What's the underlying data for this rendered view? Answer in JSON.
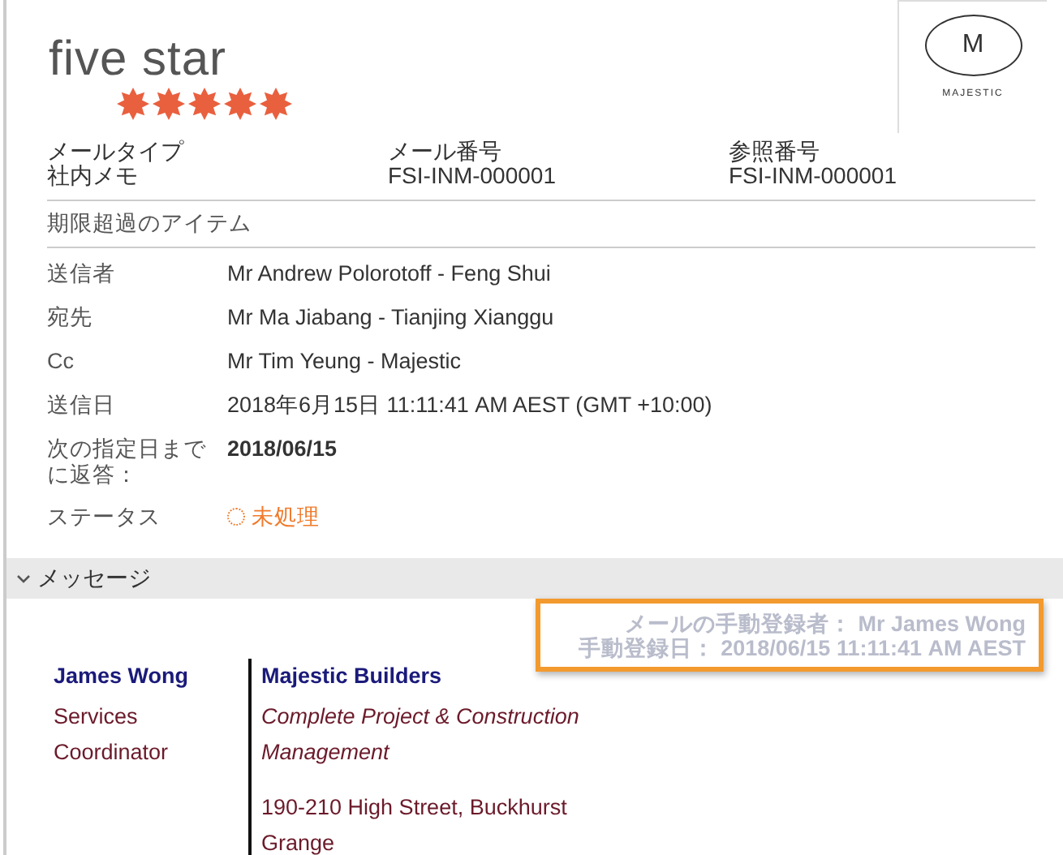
{
  "logo": {
    "wordmark": "five star",
    "stars": 5
  },
  "brand_logo": {
    "letter": "M",
    "name": "MAJESTIC"
  },
  "header_fields": [
    {
      "label": "メールタイプ",
      "value": "社内メモ"
    },
    {
      "label": "メール番号",
      "value": "FSI-INM-000001"
    },
    {
      "label": "参照番号",
      "value": "FSI-INM-000001"
    }
  ],
  "overdue_label": "期限超過のアイテム",
  "details": [
    {
      "label": "送信者",
      "value": "Mr Andrew Polorotoff - Feng Shui",
      "kind": "text"
    },
    {
      "label": "宛先",
      "value": "Mr Ma Jiabang - Tianjing Xianggu",
      "kind": "text"
    },
    {
      "label": "Cc",
      "value": "Mr Tim Yeung - Majestic",
      "kind": "text"
    },
    {
      "label": "送信日",
      "value": "2018年6月15日 11:11:41 AM AEST (GMT +10:00)",
      "kind": "text"
    },
    {
      "label": "次の指定日までに返答：",
      "value": "2018/06/15",
      "kind": "bold"
    },
    {
      "label": "ステータス",
      "value": "未処理",
      "kind": "status",
      "color": "#f07b2c"
    }
  ],
  "message_section": {
    "title": "メッセージ",
    "expanded": true
  },
  "manual_entry": [
    "メールの手動登録者： Mr James Wong",
    "手動登録日： 2018/06/15 11:11:41 AM AEST"
  ],
  "signature": {
    "name": "James Wong",
    "title_lines": [
      "Services",
      "Coordinator"
    ],
    "company": "Majestic Builders",
    "tagline_lines": [
      "Complete Project & Construction",
      "Management"
    ],
    "address_lines": [
      "190-210 High Street, Buckhurst",
      "Grange"
    ]
  }
}
